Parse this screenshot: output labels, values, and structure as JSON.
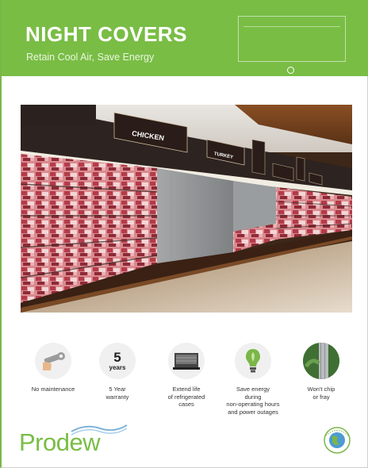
{
  "header": {
    "title": "NIGHT COVERS",
    "subtitle": "Retain Cool Air, Save Energy",
    "accent_color": "#79bd45"
  },
  "photo": {
    "signs": [
      "CHICKEN",
      "TURKEY",
      "",
      "",
      "",
      ""
    ]
  },
  "features": [
    {
      "icon": "wrench-icon",
      "label": "No maintenance"
    },
    {
      "icon": "warranty-icon",
      "number": "5",
      "unit": "years",
      "label": "5 Year\nwarranty"
    },
    {
      "icon": "display-case-icon",
      "label": "Extend life\nof refrigerated\ncases"
    },
    {
      "icon": "light-bulb-icon",
      "label": "Save energy\nduring\nnon-operating hours\nand power outages"
    },
    {
      "icon": "fabric-icon",
      "label": "Won't chip\nor fray"
    }
  ],
  "footer": {
    "logo": "Prodew",
    "badge_icon": "eco-globe-icon"
  }
}
